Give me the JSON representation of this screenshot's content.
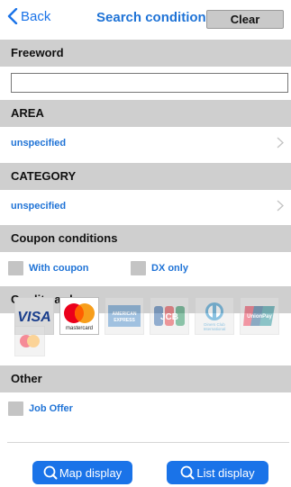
{
  "navbar": {
    "back_label": "Back",
    "title": "Search condition",
    "clear_label": "Clear"
  },
  "freeword": {
    "header": "Freeword",
    "value": "",
    "placeholder": ""
  },
  "area": {
    "header": "AREA",
    "value": "unspecified"
  },
  "category": {
    "header": "CATEGORY",
    "value": "unspecified"
  },
  "coupon": {
    "header": "Coupon conditions",
    "options": [
      {
        "label": "With coupon",
        "checked": false
      },
      {
        "label": "DX only",
        "checked": false
      }
    ]
  },
  "credit_cards": {
    "header": "Credit cards",
    "cards": [
      {
        "name": "VISA",
        "icon": "visa-icon",
        "selected": true
      },
      {
        "name": "mastercard",
        "icon": "mastercard-icon",
        "selected": true
      },
      {
        "name": "AMERICAN EXPRESS",
        "icon": "amex-icon",
        "selected": false
      },
      {
        "name": "JCB",
        "icon": "jcb-icon",
        "selected": false
      },
      {
        "name": "Diners Club International",
        "icon": "diners-icon",
        "selected": false
      },
      {
        "name": "UnionPay 银联",
        "icon": "unionpay-icon",
        "selected": false
      },
      {
        "name": "mastercard",
        "icon": "mastercard-small-icon",
        "selected": false
      }
    ]
  },
  "other": {
    "header": "Other",
    "options": [
      {
        "label": "Job Offer",
        "checked": false
      }
    ]
  },
  "bottom": {
    "map_label": "Map display",
    "list_label": "List display"
  },
  "colors": {
    "accent": "#1a73e8",
    "link": "#1f73d6",
    "section": "#cfcfcf"
  }
}
